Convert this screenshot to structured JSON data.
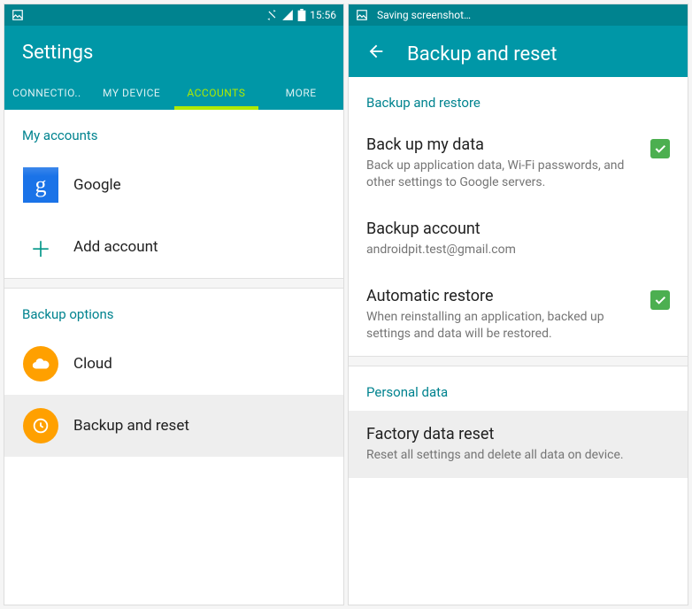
{
  "left": {
    "statusbar": {
      "time": "15:56"
    },
    "title": "Settings",
    "tabs": [
      "CONNECTIO..",
      "MY DEVICE",
      "ACCOUNTS",
      "MORE"
    ],
    "active_tab": 2,
    "accounts_header": "My accounts",
    "accounts": {
      "google": "Google",
      "add": "Add account"
    },
    "backup_header": "Backup options",
    "backup_items": {
      "cloud": "Cloud",
      "reset": "Backup and reset"
    }
  },
  "right": {
    "statusbar": {
      "notif": "Saving screenshot…"
    },
    "title": "Backup and reset",
    "section1": "Backup and restore",
    "items": {
      "backup_data": {
        "title": "Back up my data",
        "sub": "Back up application data, Wi-Fi passwords, and other settings to Google servers."
      },
      "backup_account": {
        "title": "Backup account",
        "sub": "androidpit.test@gmail.com"
      },
      "auto_restore": {
        "title": "Automatic restore",
        "sub": "When reinstalling an application, backed up settings and data will be restored."
      }
    },
    "section2": "Personal data",
    "factory": {
      "title": "Factory data reset",
      "sub": "Reset all settings and delete all data on device."
    }
  }
}
